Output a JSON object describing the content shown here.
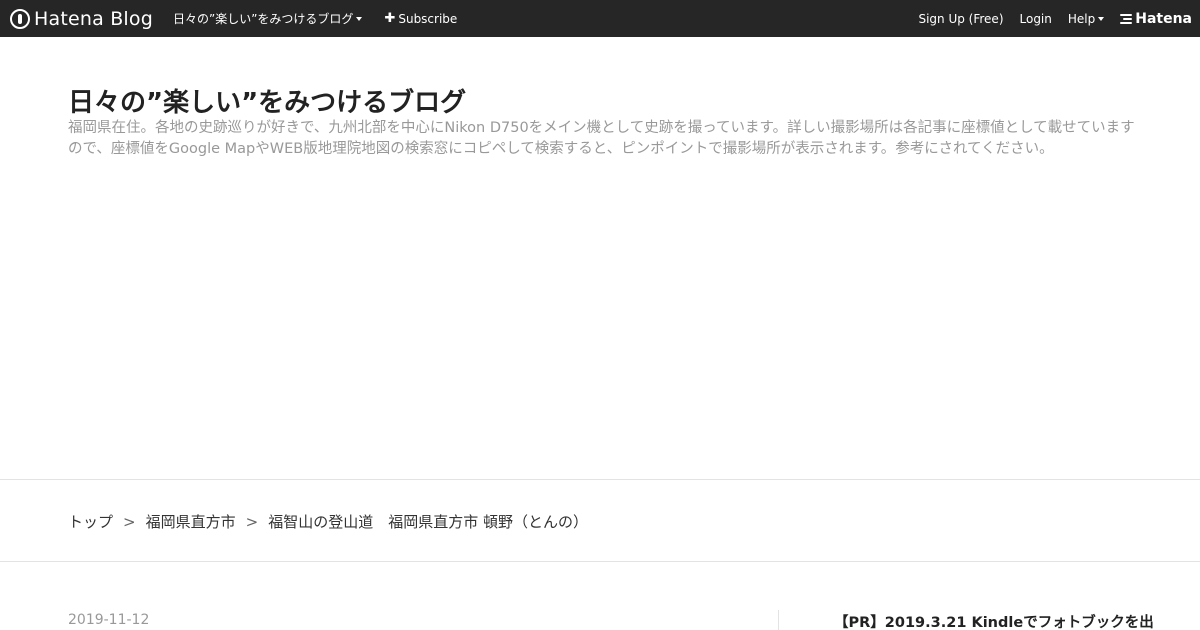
{
  "globalbar": {
    "logo_text": "Hatena Blog",
    "blog_menu": "日々の”楽しい”をみつけるブログ",
    "subscribe": "Subscribe",
    "signup": "Sign Up (Free)",
    "login": "Login",
    "help": "Help",
    "hatena": "Hatena"
  },
  "header": {
    "title": "日々の”楽しい”をみつけるブログ",
    "description": "福岡県在住。各地の史跡巡りが好きで、九州北部を中心にNikon D750をメイン機として史跡を撮っています。詳しい撮影場所は各記事に座標値として載せていますので、座標値をGoogle MapやWEB版地理院地図の検索窓にコピペして検索すると、ピンポイントで撮影場所が表示されます。参考にされてください。"
  },
  "breadcrumb": {
    "items": [
      "トップ",
      "福岡県直方市",
      "福智山の登山道　福岡県直方市 頓野（とんの）"
    ],
    "separator": ">"
  },
  "entry": {
    "date": "2019-11-12"
  },
  "sidebar": {
    "title": "【PR】2019.3.21 Kindleでフォトブックを出"
  }
}
